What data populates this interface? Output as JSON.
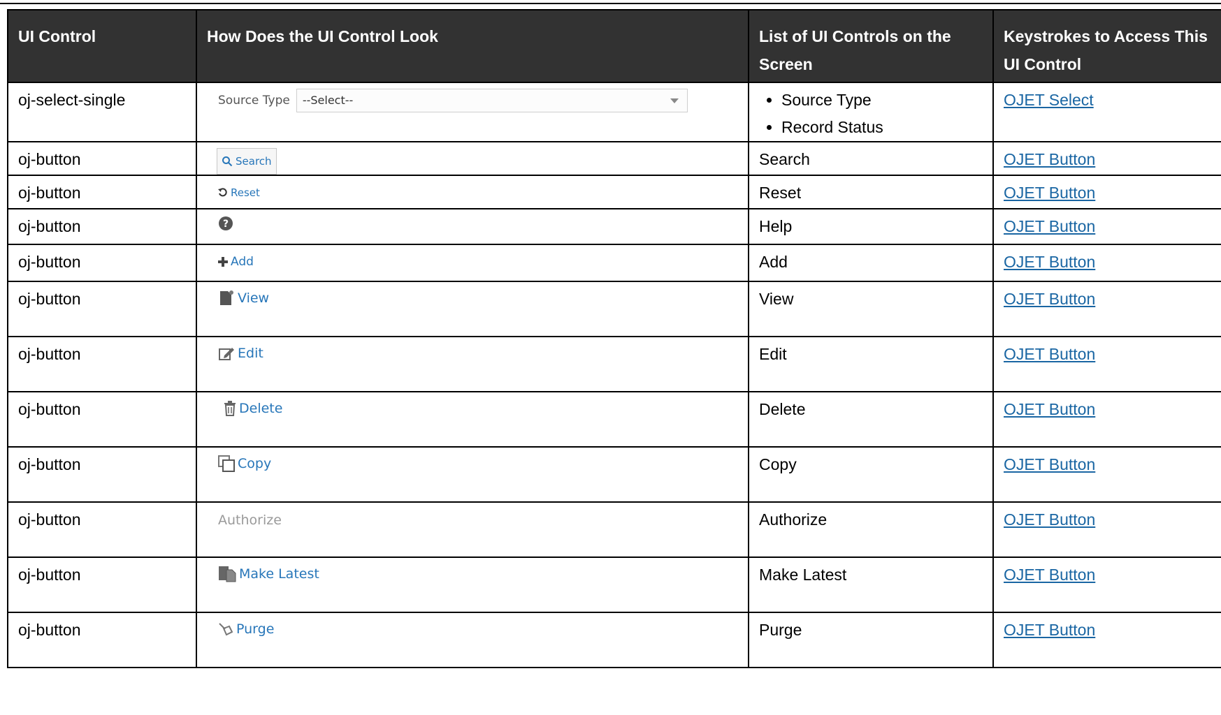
{
  "headers": {
    "col1": "UI Control",
    "col2": "How Does the UI Control Look",
    "col3": "List of UI Controls on the Screen",
    "col4": "Keystrokes to Access This UI Control"
  },
  "rows": [
    {
      "control": "oj-select-single",
      "look_label": "Source Type",
      "look_value": "--Select--",
      "screen_items": [
        "Source Type",
        "Record Status"
      ],
      "link": "OJET Select"
    },
    {
      "control": "oj-button",
      "look_label": "Search",
      "look_icon": "search-icon",
      "screen": "Search",
      "link": "OJET Button"
    },
    {
      "control": "oj-button",
      "look_label": "Reset",
      "look_icon": "reset-icon",
      "screen": "Reset",
      "link": "OJET Button"
    },
    {
      "control": "oj-button",
      "look_label": "",
      "look_icon": "help-icon",
      "screen": "Help",
      "link": "OJET Button"
    },
    {
      "control": "oj-button",
      "look_label": "Add",
      "look_icon": "plus-icon",
      "screen": "Add",
      "link": "OJET Button"
    },
    {
      "control": "oj-button",
      "look_label": "View",
      "look_icon": "view-icon",
      "screen": "View",
      "link": "OJET Button"
    },
    {
      "control": "oj-button",
      "look_label": "Edit",
      "look_icon": "edit-icon",
      "screen": "Edit",
      "link": "OJET Button"
    },
    {
      "control": "oj-button",
      "look_label": "Delete",
      "look_icon": "trash-icon",
      "screen": "Delete",
      "link": "OJET Button"
    },
    {
      "control": "oj-button",
      "look_label": "Copy",
      "look_icon": "copy-icon",
      "screen": "Copy",
      "link": "OJET Button"
    },
    {
      "control": "oj-button",
      "look_label": "Authorize",
      "look_icon": "",
      "screen": "Authorize",
      "link": "OJET Button"
    },
    {
      "control": "oj-button",
      "look_label": "Make Latest",
      "look_icon": "make-latest-icon",
      "screen": "Make Latest",
      "link": "OJET Button"
    },
    {
      "control": "oj-button",
      "look_label": "Purge",
      "look_icon": "purge-icon",
      "screen": "Purge",
      "link": "OJET Button"
    }
  ],
  "colors": {
    "header_bg": "#323232",
    "link": "#1a66a3",
    "button_text": "#2776b9",
    "disabled_text": "#9a9a9a"
  }
}
